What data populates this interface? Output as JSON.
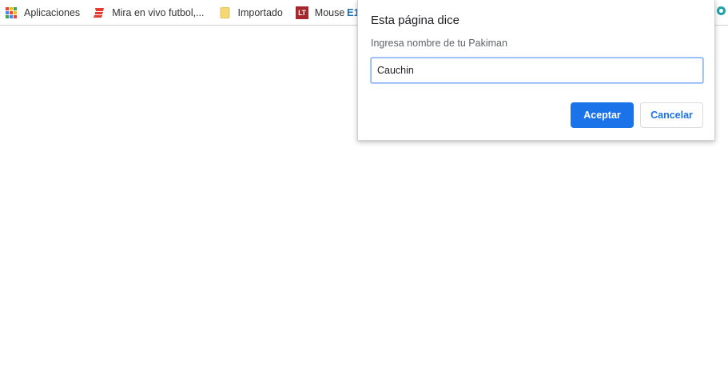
{
  "bookmarks_bar": {
    "items": [
      {
        "label": "Aplicaciones",
        "icon": "apps-grid-icon"
      },
      {
        "label": "Mira en vivo futbol,...",
        "icon": "football-site-icon"
      },
      {
        "label": "Importado",
        "icon": "folder-icon"
      },
      {
        "label": "Mouse",
        "icon": "lt-icon",
        "icon_text": "LT"
      }
    ],
    "partial_item_text": "E1",
    "colors": {
      "apps_grid": [
        "#ea4335",
        "#fbbc05",
        "#34a853",
        "#4285f4",
        "#ea4335",
        "#fbbc05",
        "#34a853",
        "#4285f4",
        "#ea4335"
      ],
      "folder": "#f7d774",
      "lt_badge": "#a5272d"
    }
  },
  "dialog": {
    "title": "Esta página dice",
    "message": "Ingresa nombre de tu Pakiman",
    "input_value": "Cauchin",
    "ok_label": "Aceptar",
    "cancel_label": "Cancelar",
    "accent_color": "#1a73e8"
  }
}
